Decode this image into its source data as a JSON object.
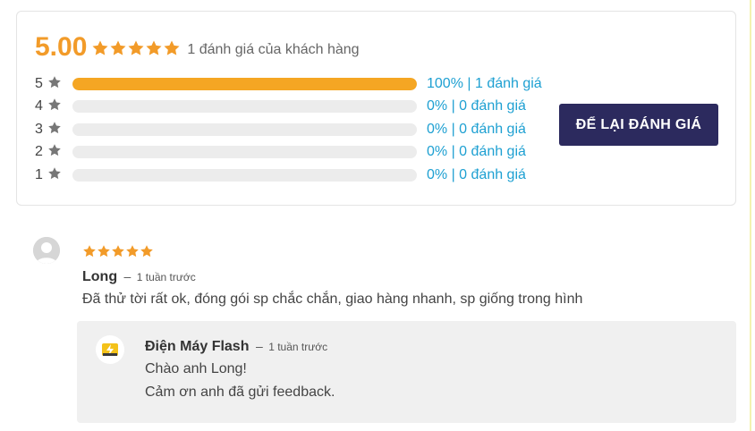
{
  "summary": {
    "average": "5.00",
    "average_stars": 5,
    "count_text": "1 đánh giá của khách hàng",
    "distribution": [
      {
        "stars": "5",
        "fraction": 1.0,
        "text": "100% | 1 đánh giá"
      },
      {
        "stars": "4",
        "fraction": 0.0,
        "text": "0% | 0 đánh giá"
      },
      {
        "stars": "3",
        "fraction": 0.0,
        "text": "0% | 0 đánh giá"
      },
      {
        "stars": "2",
        "fraction": 0.0,
        "text": "0% | 0 đánh giá"
      },
      {
        "stars": "1",
        "fraction": 0.0,
        "text": "0% | 0 đánh giá"
      }
    ],
    "leave_review_label": "ĐỂ LẠI ĐÁNH GIÁ"
  },
  "review": {
    "rating": 5,
    "author": "Long",
    "separator": "–",
    "time": "1 tuần trước",
    "text": "Đã thử tời rất ok, đóng gói sp chắc chắn, giao hàng nhanh, sp giống trong hình",
    "avatar_icon": "default-user-icon"
  },
  "reply": {
    "author": "Điện Máy Flash",
    "separator": "–",
    "time": "1 tuần trước",
    "line1": "Chào anh Long!",
    "line2": "Cảm ơn anh đã gửi feedback.",
    "avatar_icon": "dien-may-flash-logo"
  },
  "colors": {
    "accent_orange": "#f29b29",
    "bar_fill": "#f5a623",
    "link_blue": "#1ea0d2",
    "button_navy": "#2c2a5e",
    "star_gray": "#777777"
  }
}
